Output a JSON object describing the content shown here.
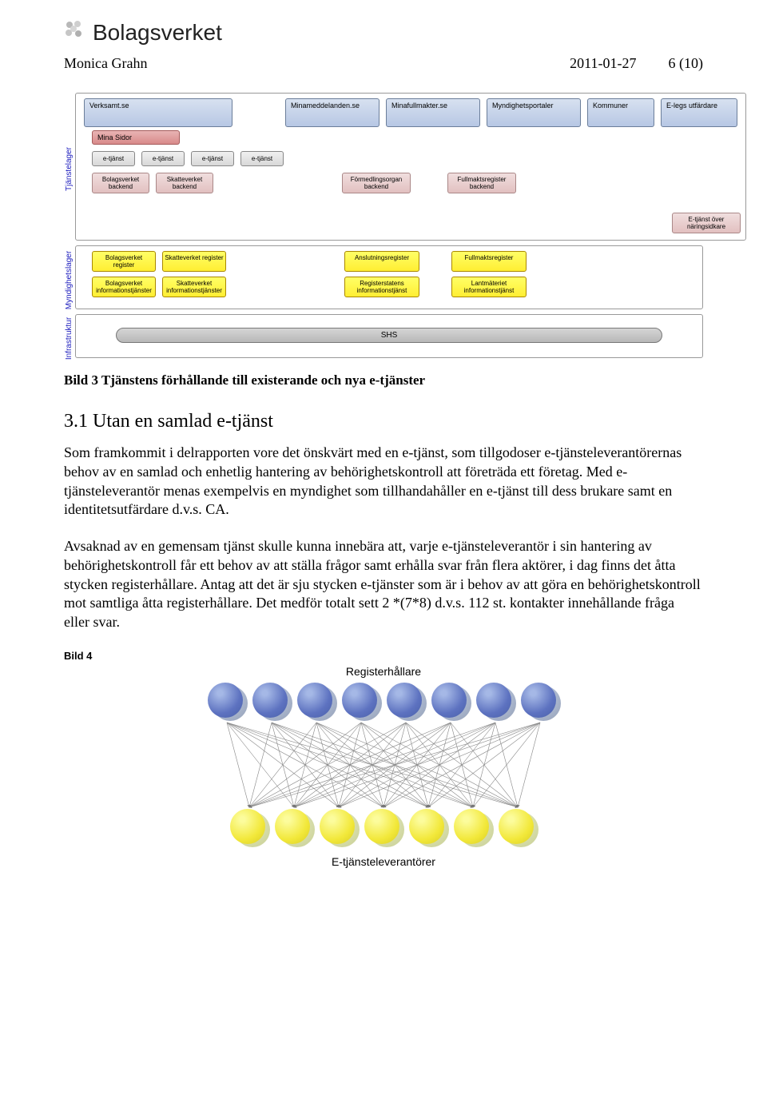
{
  "header": {
    "org": "Bolagsverket",
    "author": "Monica Grahn",
    "date": "2011-01-27",
    "page": "6 (10)"
  },
  "diagram": {
    "axis_labels": {
      "tjanst": "Tjänstelager",
      "mynd": "Myndighetslager",
      "infra": "Infrastruktur"
    },
    "top_row": {
      "verksamt": "Verksamt.se",
      "minamedd": "Minameddelanden.se",
      "minafull": "Minafullmakter.se",
      "myndport": "Myndighetsportaler",
      "kommuner": "Kommuner",
      "elegs": "E-legs utfärdare"
    },
    "mina_sidor": "Mina Sidor",
    "etjanst": "e-tjänst",
    "backend": {
      "bolag": "Bolagsverket backend",
      "skatt": "Skatteverket backend",
      "formedl": "Förmedlingsorgan backend",
      "fullmakt": "Fullmaktsregister backend",
      "naringsidk": "E-tjänst över näringsidkare"
    },
    "mynd_boxes": {
      "bolag_reg": "Bolagsverket register",
      "skatt_reg": "Skatteverket register",
      "anslut": "Anslutningsregister",
      "fullmakt_reg": "Fullmaktsregister",
      "bolag_info": "Bolagsverket informationstjänster",
      "skatt_info": "Skatteverket informationstjänster",
      "regstat": "Registerstatens informationstjänst",
      "lantm": "Lantmäteriet informationstjänst"
    },
    "shs": "SHS"
  },
  "caption_bild3": "Bild 3 Tjänstens förhållande till existerande och nya e-tjänster",
  "section_heading": "3.1 Utan en samlad e-tjänst",
  "para1": "Som framkommit i delrapporten vore det önskvärt med en e-tjänst, som tillgodoser e-tjänsteleverantörernas behov av en samlad och enhetlig hantering av behörighetskontroll att företräda ett företag. Med e-tjänsteleverantör menas exempelvis en myndighet som tillhandahåller en e-tjänst till dess brukare samt en identitetsutfärdare d.v.s. CA.",
  "para2": "Avsaknad av en gemensam tjänst skulle kunna innebära att, varje e-tjänsteleverantör i sin hantering av behörighetskontroll får ett behov av att ställa frågor samt erhålla svar från flera aktörer, i dag finns det åtta stycken registerhållare. Antag att det är sju stycken e-tjänster som är i behov av att göra en behörighetskontroll mot samtliga åtta registerhållare. Det medför totalt sett 2 *(7*8) d.v.s. 112 st. kontakter innehållande fråga eller svar.",
  "bild4_label": "Bild 4",
  "registerhallare_label": "Registerhållare",
  "leverantorer_label": "E-tjänsteleverantörer",
  "chart_data": {
    "type": "bipartite-graph",
    "top_count": 8,
    "bottom_count": 7,
    "note": "fully connected bipartite, arrows both directions, 112 contacts total"
  }
}
